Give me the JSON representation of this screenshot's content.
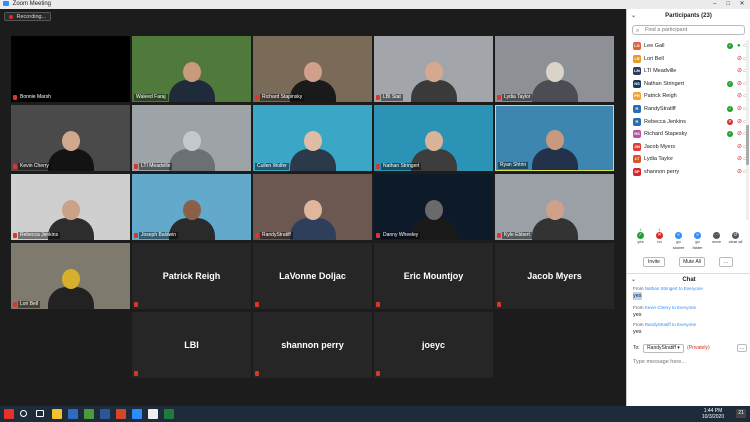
{
  "window": {
    "title": "Zoom Meeting",
    "controls": [
      "–",
      "□",
      "✕"
    ]
  },
  "recording": {
    "label": "Recording..."
  },
  "grid": {
    "tiles": [
      {
        "name": "Bonnie Marsh",
        "type": "blank",
        "muted": true
      },
      {
        "name": "Waleed Faraj",
        "type": "video",
        "bg": "#4f7a3c",
        "skin": "#c99b7a",
        "shirt": "#1f2a3a",
        "muted": false
      },
      {
        "name": "Richard Stapinsky",
        "type": "video",
        "bg": "#7a6a58",
        "skin": "#d0a08a",
        "shirt": "#1a1a1a",
        "muted": true
      },
      {
        "name": "LBI Stat",
        "type": "video",
        "bg": "#a2a6ab",
        "skin": "#d6a890",
        "shirt": "#3a3a3a",
        "muted": true
      },
      {
        "name": "Lydia Taylor",
        "type": "video",
        "bg": "#8d9196",
        "skin": "#dad3c8",
        "shirt": "#4a4e54",
        "muted": true
      },
      {
        "name": "Kevin Cherry",
        "type": "video",
        "bg": "#4a4a4a",
        "skin": "#cfa88e",
        "shirt": "#131313",
        "muted": true
      },
      {
        "name": "LTI Meadville",
        "type": "video",
        "bg": "#9ea3a8",
        "skin": "#c4c8cc",
        "shirt": "#6c7075",
        "muted": true
      },
      {
        "name": "Cullen Wolfer",
        "type": "video",
        "bg": "#3aa7c7",
        "skin": "#e1bca4",
        "shirt": "#2a3a4a",
        "muted": false
      },
      {
        "name": "Nathan Stringert",
        "type": "video",
        "bg": "#2b93b6",
        "skin": "#d9b29a",
        "shirt": "#3d3d3d",
        "muted": true
      },
      {
        "name": "Ryan Shtrin",
        "type": "video",
        "bg": "#3c86b0",
        "skin": "#c79a80",
        "shirt": "#23324a",
        "muted": false,
        "speaking": true
      },
      {
        "name": "Rebecca Jenkins",
        "type": "video",
        "bg": "#cfcfcf",
        "skin": "#caa288",
        "shirt": "#2d2d2d",
        "muted": true
      },
      {
        "name": "Joseph Baldwin",
        "type": "video",
        "bg": "#62a9cc",
        "skin": "#8a6048",
        "shirt": "#2a2a2a",
        "muted": true
      },
      {
        "name": "RandyStratiff",
        "type": "video",
        "bg": "#6c5850",
        "skin": "#e0b69c",
        "shirt": "#2e3f5c",
        "muted": true
      },
      {
        "name": "Danny Wheeley",
        "type": "video",
        "bg": "#0d1a2a",
        "skin": "#6a6a6a",
        "shirt": "#1a1a1a",
        "muted": true
      },
      {
        "name": "Kyle Ebbert",
        "type": "video",
        "bg": "#9aa0a6",
        "skin": "#cfa08a",
        "shirt": "#333333",
        "muted": true
      },
      {
        "name": "Lori Bell",
        "type": "video",
        "bg": "#7e7a6e",
        "skin": "#d6b02a",
        "shirt": "#222222",
        "muted": true
      },
      {
        "name": "Patrick Reigh",
        "type": "name",
        "muted": true
      },
      {
        "name": "LaVonne Doljac",
        "type": "name",
        "muted": true
      },
      {
        "name": "Eric Mountjoy",
        "type": "name",
        "muted": true
      },
      {
        "name": "Jacob Myers",
        "type": "name",
        "muted": true
      },
      {
        "name": "LBI",
        "type": "name",
        "muted": true
      },
      {
        "name": "shannon perry",
        "type": "name",
        "muted": true
      },
      {
        "name": "joeyc",
        "type": "name",
        "muted": true
      }
    ]
  },
  "participants": {
    "title": "Participants (23)",
    "search_placeholder": "Find a participant",
    "list": [
      {
        "initials": "LG",
        "name": "Lee Gall",
        "color": "#e0633a",
        "status": "ok",
        "mic": "on"
      },
      {
        "initials": "LB",
        "name": "Lori Bell",
        "color": "#e39b2b",
        "status": "",
        "mic": "off"
      },
      {
        "initials": "LM",
        "name": "LTI Meadville",
        "color": "#2b3d5e",
        "status": "",
        "mic": "off"
      },
      {
        "initials": "NS",
        "name": "Nathan Stringert",
        "color": "#1b3a5c",
        "status": "ok",
        "mic": "off"
      },
      {
        "initials": "PR",
        "name": "Patrick Reigh",
        "color": "#f0a32b",
        "status": "",
        "mic": "off"
      },
      {
        "initials": "R",
        "name": "RandyStratiff",
        "color": "#2b6cb0",
        "status": "ok",
        "mic": "off"
      },
      {
        "initials": "R",
        "name": "Rebecca Jenkins",
        "color": "#2b6cb0",
        "status": "no",
        "mic": "off"
      },
      {
        "initials": "RS",
        "name": "Richard Stapesky",
        "color": "#b84fb0",
        "status": "ok",
        "mic": "off"
      },
      {
        "initials": "JM",
        "name": "Jacob Myers",
        "color": "#e03a3a",
        "status": "",
        "mic": "off"
      },
      {
        "initials": "LT",
        "name": "Lydia Taylor",
        "color": "#d8542a",
        "status": "",
        "mic": "off"
      },
      {
        "initials": "SP",
        "name": "shannon perry",
        "color": "#d62a2a",
        "status": "",
        "mic": "off"
      }
    ],
    "reactions": [
      {
        "count": "1",
        "label": "yes",
        "color": "#1fa02e",
        "glyph": "✓"
      },
      {
        "count": "1",
        "label": "no",
        "color": "#d62a2a",
        "glyph": "✕"
      },
      {
        "count": "",
        "label": "go slower",
        "color": "#2d8cff",
        "glyph": "«"
      },
      {
        "count": "",
        "label": "go faster",
        "color": "#2d8cff",
        "glyph": "»"
      },
      {
        "count": "",
        "label": "more",
        "color": "#555555",
        "glyph": "⋯"
      },
      {
        "count": "",
        "label": "clear all",
        "color": "#555555",
        "glyph": "↺"
      }
    ],
    "buttons": [
      "Invite",
      "Mute All",
      "..."
    ]
  },
  "chat": {
    "title": "Chat",
    "messages": [
      {
        "from_prefix": "From",
        "from": "Nathan Stringert",
        "to": "to Everyone",
        "text": "yes",
        "highlight": true
      },
      {
        "from_prefix": "From",
        "from": "Kevin Cherry",
        "to": "to Everyone",
        "text": "yes",
        "highlight": false
      },
      {
        "from_prefix": "From",
        "from": "RandyStratiff",
        "to": "to Everyone",
        "text": "yes",
        "highlight": false
      }
    ],
    "to_label": "To:",
    "to_value": "RandyStratiff ▾",
    "private_label": "(Privately)",
    "more_label": "...",
    "input_placeholder": "Type message here..."
  },
  "taskbar": {
    "time": "1:44 PM",
    "date": "10/3/2020",
    "notif_count": "21",
    "icons": [
      {
        "name": "windows",
        "color": "#e7302a"
      },
      {
        "name": "search",
        "color": "#ffffff"
      },
      {
        "name": "task-view",
        "color": "#ffffff"
      },
      {
        "name": "file-explorer",
        "color": "#f2c12e"
      },
      {
        "name": "mail",
        "color": "#2d6cc0"
      },
      {
        "name": "chrome",
        "color": "#4c9a3c"
      },
      {
        "name": "word",
        "color": "#2b579a"
      },
      {
        "name": "powerpoint",
        "color": "#d24726"
      },
      {
        "name": "zoom",
        "color": "#2d8cff"
      },
      {
        "name": "photos",
        "color": "#eeeeee"
      },
      {
        "name": "excel",
        "color": "#1f7a3e"
      }
    ]
  }
}
